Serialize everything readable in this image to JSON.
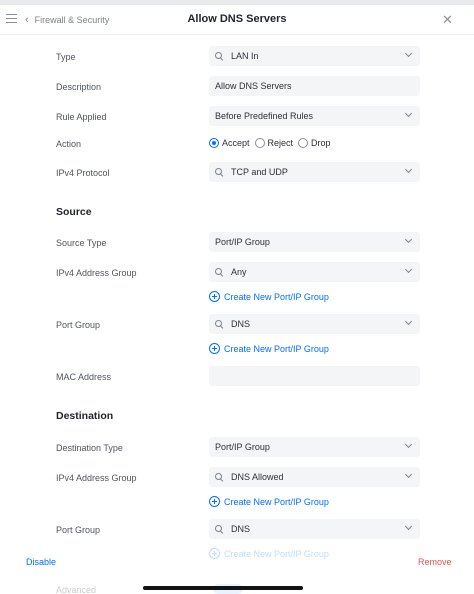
{
  "header": {
    "back_label": "Firewall & Security",
    "title": "Allow DNS Servers"
  },
  "general": {
    "type_label": "Type",
    "type_value": "LAN In",
    "description_label": "Description",
    "description_value": "Allow DNS Servers",
    "rule_applied_label": "Rule Applied",
    "rule_applied_value": "Before Predefined Rules",
    "action_label": "Action",
    "action_options": [
      "Accept",
      "Reject",
      "Drop"
    ],
    "action_selected": "Accept",
    "protocol_label": "IPv4 Protocol",
    "protocol_value": "TCP and UDP"
  },
  "source": {
    "heading": "Source",
    "source_type_label": "Source Type",
    "source_type_value": "Port/IP Group",
    "address_group_label": "IPv4 Address Group",
    "address_group_value": "Any",
    "create_link_1": "Create New Port/IP Group",
    "port_group_label": "Port Group",
    "port_group_value": "DNS",
    "create_link_2": "Create New Port/IP Group",
    "mac_label": "MAC Address",
    "mac_value": ""
  },
  "destination": {
    "heading": "Destination",
    "dest_type_label": "Destination Type",
    "dest_type_value": "Port/IP Group",
    "address_group_label": "IPv4 Address Group",
    "address_group_value": "DNS Allowed",
    "create_link_1": "Create New Port/IP Group",
    "port_group_label": "Port Group",
    "port_group_value": "DNS",
    "create_link_2": "Create New Port/IP Group"
  },
  "footer": {
    "disable_label": "Disable",
    "remove_label": "Remove",
    "advanced_label": "Advanced"
  },
  "colors": {
    "accent": "#006fff",
    "danger": "#e0564d",
    "field_bg": "#f4f5f7"
  },
  "icons": [
    "menu-icon",
    "chevron-left-icon",
    "close-icon",
    "search-icon",
    "chevron-down-icon",
    "plus-circle-icon"
  ]
}
